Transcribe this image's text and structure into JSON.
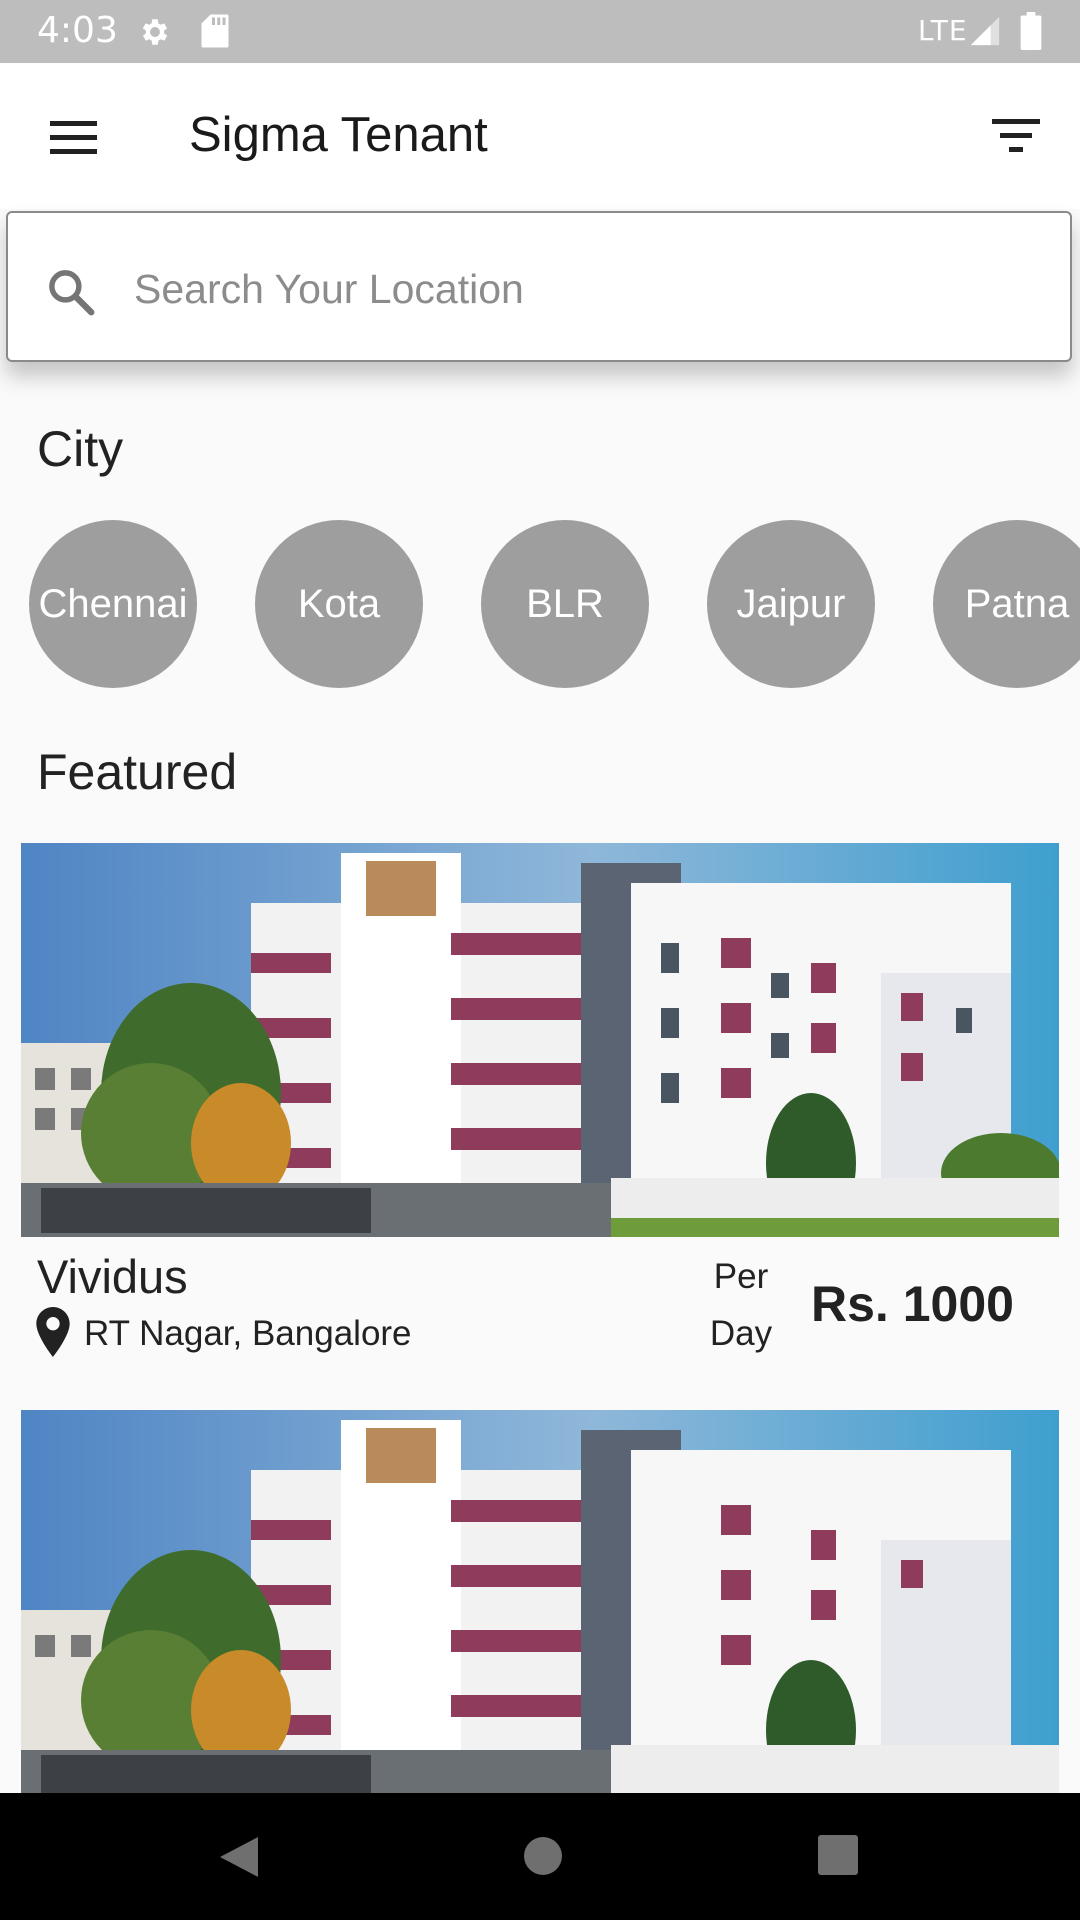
{
  "status_bar": {
    "time": "4:03",
    "network": "LTE"
  },
  "app_bar": {
    "title": "Sigma Tenant",
    "menu_icon": "hamburger-menu-icon",
    "filter_icon": "filter-icon"
  },
  "search": {
    "placeholder": "Search Your Location",
    "value": ""
  },
  "city_section": {
    "heading": "City",
    "cities": [
      "Chennai",
      "Kota",
      "BLR",
      "Jaipur",
      "Patna"
    ]
  },
  "featured_section": {
    "heading": "Featured",
    "properties": [
      {
        "name": "Vividus",
        "location": "RT Nagar, Bangalore",
        "per_label": "Per",
        "unit_label": "Day",
        "price": "Rs. 1000"
      },
      {
        "name": "",
        "location": "",
        "per_label": "",
        "unit_label": "",
        "price": ""
      }
    ]
  },
  "colors": {
    "city_circle": "#9e9e9e",
    "status_bar": "#bdbdbd",
    "building_accent": "#8e3b5c"
  },
  "nav_bar": {
    "back_icon": "back-triangle-icon",
    "home_icon": "home-circle-icon",
    "recent_icon": "recent-apps-square-icon"
  }
}
